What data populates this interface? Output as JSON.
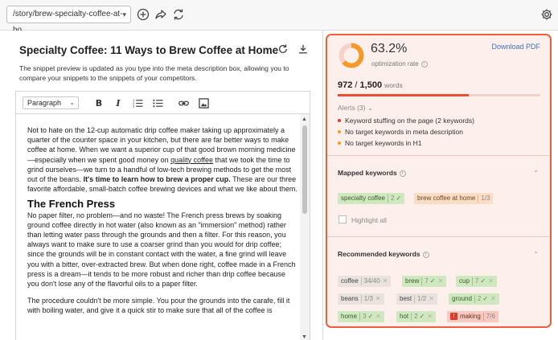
{
  "topbar": {
    "url": "/story/brew-specialty-coffee-at-ho..."
  },
  "document": {
    "title": "Specialty Coffee: 11 Ways to Brew Coffee at Home",
    "description": "The snippet preview is updated as you type into the meta description box, allowing you to compare your snippets to the snippets of your competitors."
  },
  "editor_toolbar": {
    "block_format": "Paragraph",
    "bold": "B",
    "italic": "I"
  },
  "content": {
    "intro_1": "Not to hate on the 12-cup automatic drip coffee maker taking up approximately a quarter of the counter space in your kitchen, but there are far better ways to make coffee at home. When we want a superior cup of that good brown morning medicine—especially when we spent good money on ",
    "intro_link": "quality coffee",
    "intro_2": " that we took the time to grind ourselves—we turn to a handful of low-tech brewing methods to get the most out of the beans. ",
    "intro_bold": "It's time to learn how to brew a proper cup.",
    "intro_3": " These are our three favorite affordable, small-batch coffee brewing devices and what we like about them.",
    "heading": "The French Press",
    "para_1": "No paper filter, no problem—and no waste! The French press brews by soaking ground coffee directly in hot water (also known as an \"immersion\" method) rather than letting water pass through the grounds and then a filter. For this reason, you always want to make sure to use a coarser grind than you would for drip coffee; since the grounds will be in constant contact with the water, a fine grind will leave you with a bitter, over-extracted brew. But when done right, coffee made in a French press is a dream—it tends to be more robust and richer than drip coffee because you don't lose any of the flavorful oils to a paper filter.",
    "para_2": "The procedure couldn't be more simple. You pour the grounds into the carafe, fill it with boiling water, and give it a quick stir to make sure that all of the coffee is"
  },
  "seo": {
    "score": "63.2%",
    "score_value": 0.632,
    "score_label": "optimization rate",
    "download_label": "Download PDF",
    "word_count": "972",
    "word_target": "1,500",
    "word_unit": "words",
    "word_progress": 0.648,
    "alerts_label": "Alerts (3)",
    "alerts": [
      {
        "text": "Keyword stuffing on the page (2 keywords)",
        "color": "#e0392a"
      },
      {
        "text": "No target keywords in meta description",
        "color": "#f0a020"
      },
      {
        "text": "No target keywords in H1",
        "color": "#f0a020"
      }
    ],
    "mapped_heading": "Mapped keywords",
    "mapped": [
      {
        "kw": "specialty coffee",
        "count": "2",
        "status": "ok",
        "color": "green"
      },
      {
        "kw": "brew coffee at home",
        "count": "1/3",
        "status": "",
        "color": "orange"
      }
    ],
    "highlight_label": "Highlight all",
    "recommended_heading": "Recommended keywords",
    "recommended": [
      {
        "kw": "coffee",
        "count": "34/40",
        "status": "x",
        "color": "gray"
      },
      {
        "kw": "brew",
        "count": "7",
        "status": "okx",
        "color": "green"
      },
      {
        "kw": "cup",
        "count": "7",
        "status": "okx",
        "color": "green"
      },
      {
        "kw": "beans",
        "count": "1/3",
        "status": "x",
        "color": "gray"
      },
      {
        "kw": "best",
        "count": "1/2",
        "status": "x",
        "color": "gray"
      },
      {
        "kw": "ground",
        "count": "2",
        "status": "okx",
        "color": "green"
      },
      {
        "kw": "home",
        "count": "3",
        "status": "okx",
        "color": "green"
      },
      {
        "kw": "hot",
        "count": "2",
        "status": "okx",
        "color": "green"
      },
      {
        "kw": "making",
        "count": "7/6",
        "status": "warn",
        "color": "red"
      }
    ]
  },
  "colors": {
    "accent": "#ef5d39",
    "link": "#3b73c4",
    "panel_bg": "#fdf0ec"
  }
}
